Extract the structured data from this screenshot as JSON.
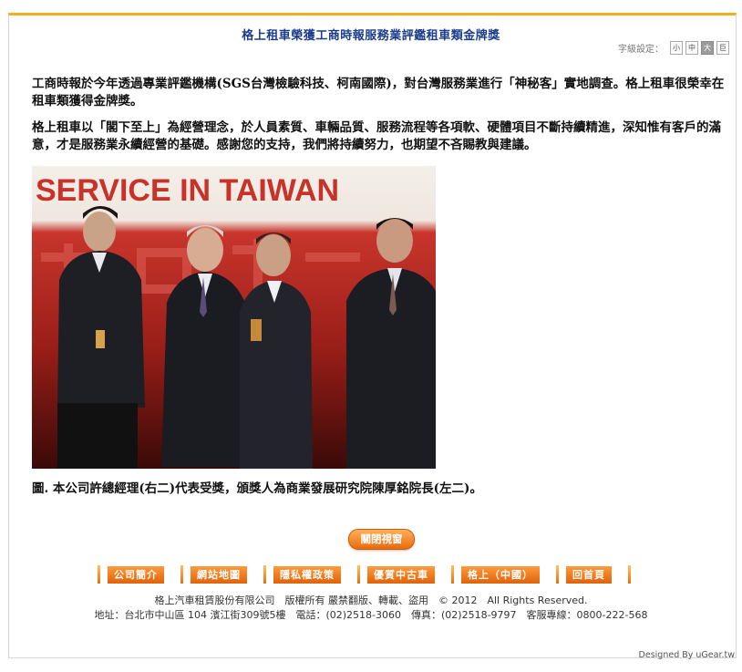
{
  "article": {
    "title": "格上租車榮獲工商時報服務業評鑑租車類金牌獎",
    "font_size_label": "字級設定：",
    "font_size_buttons": [
      "小",
      "中",
      "大",
      "巨"
    ],
    "paragraph1": "工商時報於今年透過專業評鑑機構(SGS台灣檢驗科技、柯南國際)，對台灣服務業進行「神秘客」實地調查。格上租車很榮幸在租車類獲得金牌獎。",
    "paragraph2": "格上租車以「閣下至上」為經營理念，於人員素質、車輛品質、服務流程等各項軟、硬體項目不斷持續精進，深知惟有客戶的滿意，才是服務業永續經營的基礎。感謝您的支持，我們將持續努力，也期望不吝賜教與建議。",
    "photo_banner": "SERVICE IN TAIWAN",
    "caption": "圖. 本公司許總經理(右二)代表受獎，頒獎人為商業發展研究院陳厚銘院長(左二)。"
  },
  "close_button": "關閉視窗",
  "footer": {
    "nav": [
      "公司簡介",
      "網站地圖",
      "隱私權政策",
      "優質中古車",
      "格上（中國）",
      "回首頁"
    ],
    "copyright": "格上汽車租賃股份有限公司　版權所有 嚴禁翻版、轉載、盜用　© 2012　All Rights Reserved.",
    "address": "地址：台北市中山區 104 濱江街309號5樓　電話：(02)2518-3060　傳真：(02)2518-9797　客服專線：0800-222-568",
    "designed_by": "Designed By uGear.tw"
  },
  "colors": {
    "accent": "#f2b01e",
    "title": "#1a3c8c",
    "button": "#ea6a0d"
  }
}
